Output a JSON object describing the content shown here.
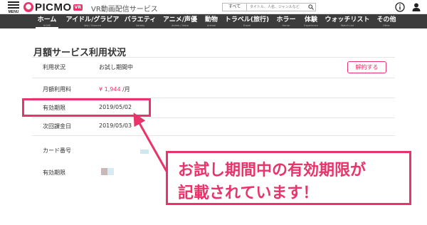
{
  "header": {
    "menu_label": "MENU",
    "logo_text": "PICMO",
    "logo_badge": "VR",
    "tagline": "VR動画配信サービス",
    "search": {
      "category": "すべて",
      "placeholder": "タイトル、人名、ジャンルなど"
    },
    "icons": [
      "info-icon",
      "user-icon"
    ]
  },
  "nav": {
    "items": [
      {
        "label": "ホーム",
        "sub": "HOME",
        "active": true
      },
      {
        "label": "アイドル/グラビア",
        "sub": "Idol / Gravure"
      },
      {
        "label": "バラエティ",
        "sub": "Variety"
      },
      {
        "label": "アニメ/声優",
        "sub": "Anime / Voice"
      },
      {
        "label": "動物",
        "sub": "Animal"
      },
      {
        "label": "トラベル(旅行)",
        "sub": "Travel"
      },
      {
        "label": "ホラー",
        "sub": "Horror"
      },
      {
        "label": "体験",
        "sub": "Experience"
      },
      {
        "label": "ウォッチリスト",
        "sub": "Watch List"
      },
      {
        "label": "その他",
        "sub": "Other"
      }
    ]
  },
  "page": {
    "title": "月額サービス利用状況",
    "cancel_label": "解約する",
    "rows": [
      {
        "label": "利用状況",
        "value": "お試し期間中"
      },
      {
        "label": "月額利用料",
        "value_amount": "¥ 1,944",
        "value_unit": " /月"
      },
      {
        "label": "有効期限",
        "value": "2019/05/02"
      },
      {
        "label": "次回課金日",
        "value": "2019/05/03"
      },
      {
        "label": "カード番号",
        "value": ""
      },
      {
        "label": "有効期限",
        "value": ""
      }
    ]
  },
  "annotation": {
    "line1": "お試し期間中の有効期限が",
    "line2": "記載されています！",
    "color": "#e8336b"
  },
  "colors": {
    "accent": "#e8336b",
    "nav_bg": "#3c3c3c"
  }
}
